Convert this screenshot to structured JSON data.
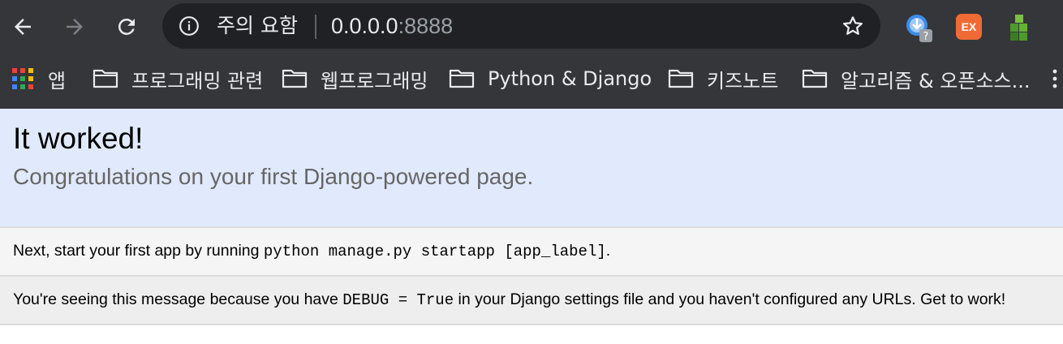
{
  "browser": {
    "security_warning": "주의 요함",
    "url_host": "0.0.0.0",
    "url_port": ":8888",
    "extensions": [
      {
        "icon": "download-helper-icon",
        "badge": "?"
      },
      {
        "icon": "ex-extension-icon",
        "label": "EX"
      },
      {
        "icon": "green-cubes-extension-icon"
      }
    ]
  },
  "bookmarks": {
    "apps_label": "앱",
    "items": [
      {
        "label": "프로그래밍 관련",
        "icon": "folder-icon"
      },
      {
        "label": "웹프로그래밍",
        "icon": "folder-icon"
      },
      {
        "label": "Python & Django",
        "icon": "folder-icon"
      },
      {
        "label": "키즈노트",
        "icon": "folder-icon"
      },
      {
        "label": "알고리즘 & 오픈소스...",
        "icon": "folder-icon"
      }
    ]
  },
  "page": {
    "title": "It worked!",
    "subtitle": "Congratulations on your first Django-powered page.",
    "instructions_pre": "Next, start your first app by running ",
    "instructions_code": "python manage.py startapp [app_label]",
    "instructions_post": ".",
    "explanation_pre": "You're seeing this message because you have ",
    "explanation_code": "DEBUG = True",
    "explanation_post": " in your Django settings file and you haven't configured any URLs. Get to work!"
  },
  "colors": {
    "toolbar": "#35363a",
    "omnibox": "#202124",
    "banner": "#e1eafc",
    "ex_badge": "#f06a35"
  }
}
